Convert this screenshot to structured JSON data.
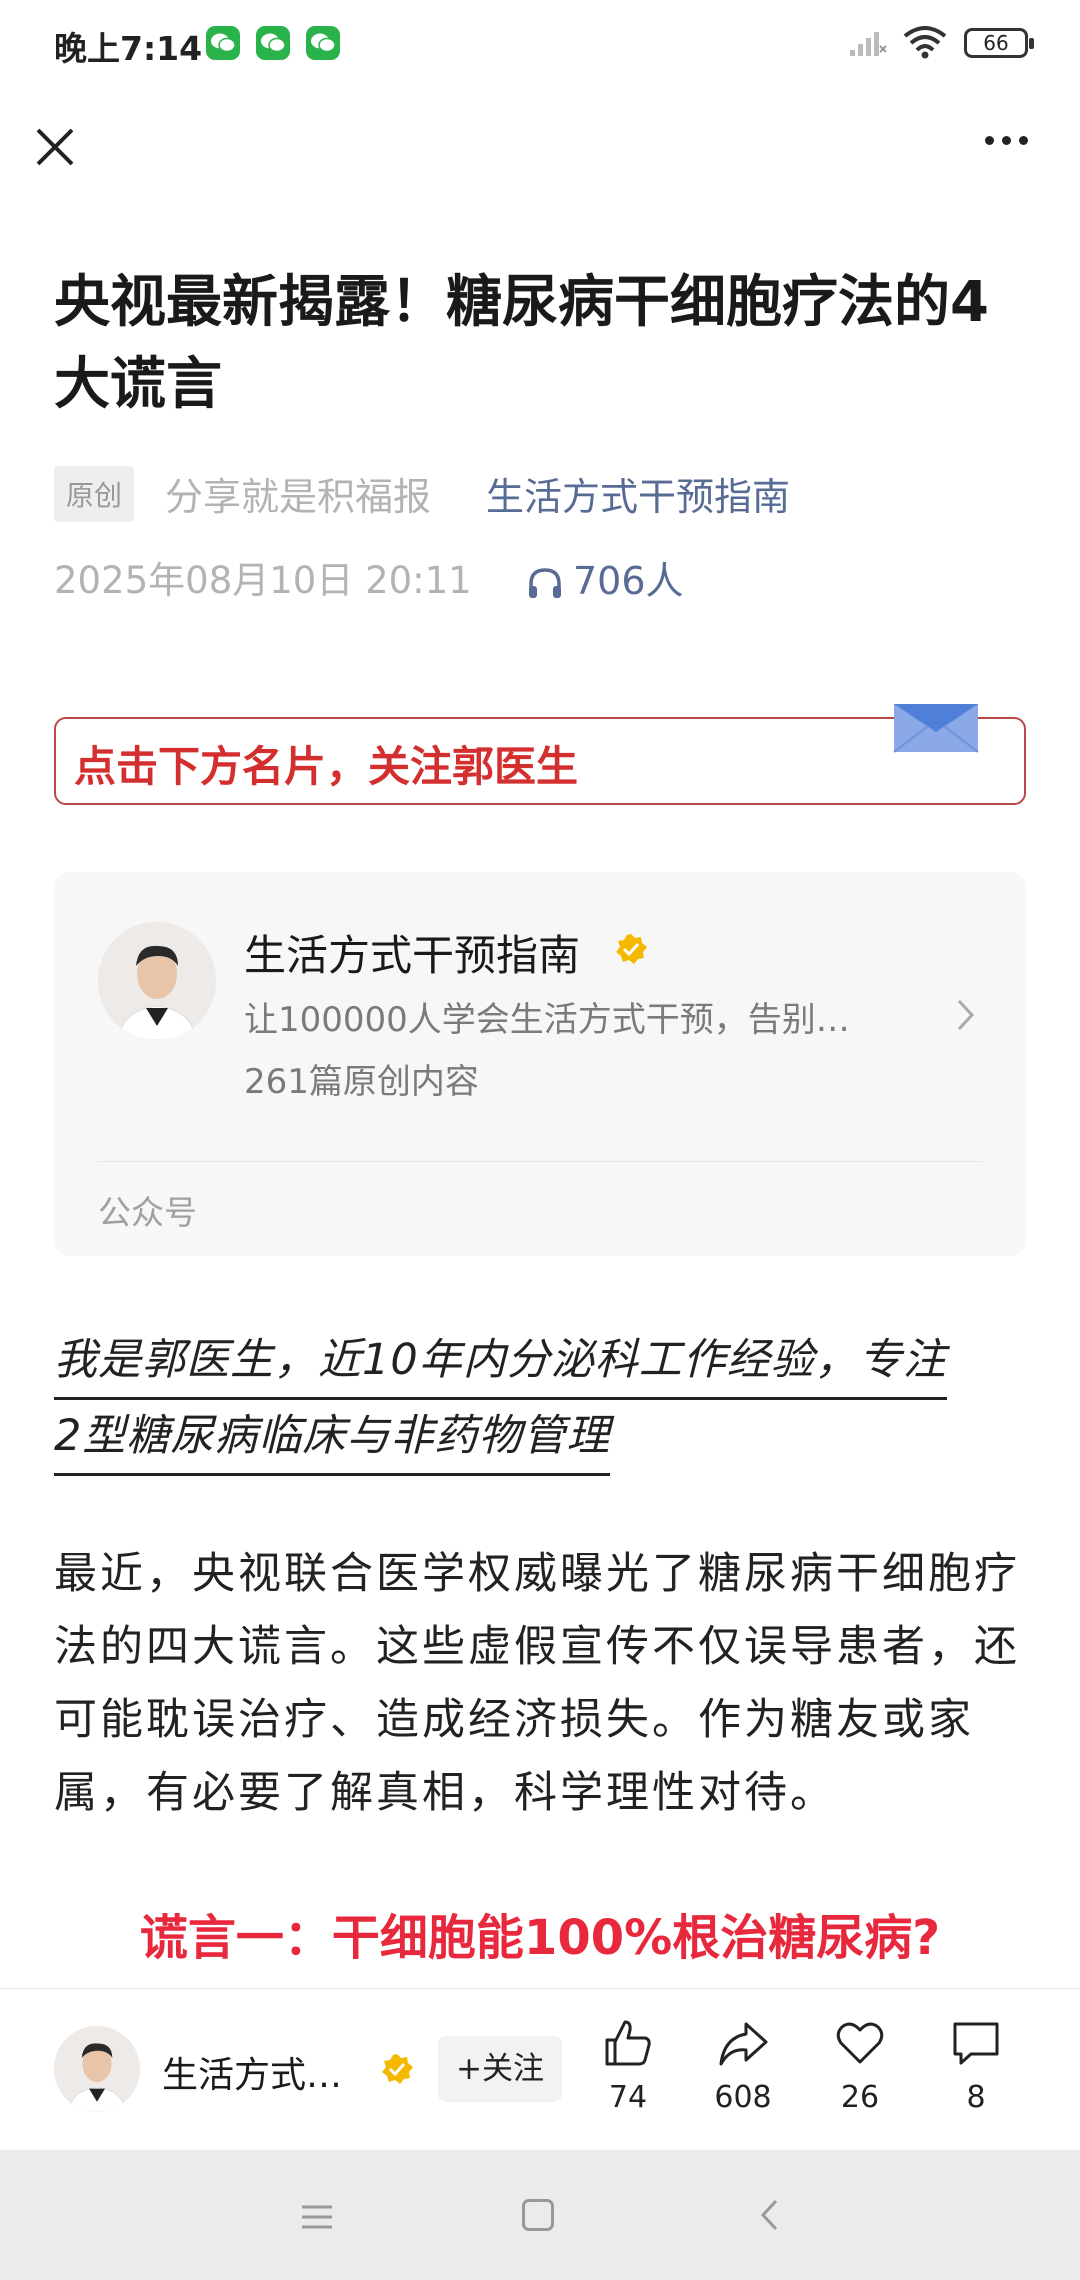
{
  "status_bar": {
    "time": "晚上7:14",
    "battery": "66"
  },
  "article": {
    "title": "央视最新揭露！糖尿病干细胞疗法的4大谎言",
    "tag": "原创",
    "author_plain": "分享就是积福报",
    "author_link": "生活方式干预指南",
    "date": "2025年08月10日 20:11",
    "listeners": "706人"
  },
  "banner": {
    "text": "点击下方名片，关注郭医生"
  },
  "profile_card": {
    "name": "生活方式干预指南",
    "description": "让100000人学会生活方式干预，告别…",
    "count": "261篇原创内容",
    "footer": "公众号"
  },
  "intro": {
    "line1": "我是郭医生，近10年内分泌科工作经验，专注",
    "line2": "2型糖尿病临床与非药物管理"
  },
  "body": "最近，央视联合医学权威曝光了糖尿病干细胞疗法的四大谎言。这些虚假宣传不仅误导患者，还可能耽误治疗、造成经济损失。作为糖友或家属，有必要了解真相，科学理性对待。",
  "section_heading": "谎言一：干细胞能100%根治糖尿病?",
  "toolbar": {
    "account_name": "生活方式…",
    "follow_label": "+关注",
    "likes": "74",
    "shares": "608",
    "favorites": "26",
    "comments": "8"
  },
  "colors": {
    "link": "#576b95",
    "accent_red": "#e8283c",
    "wechat_green": "#2ab24b",
    "verified": "#f5b800"
  }
}
